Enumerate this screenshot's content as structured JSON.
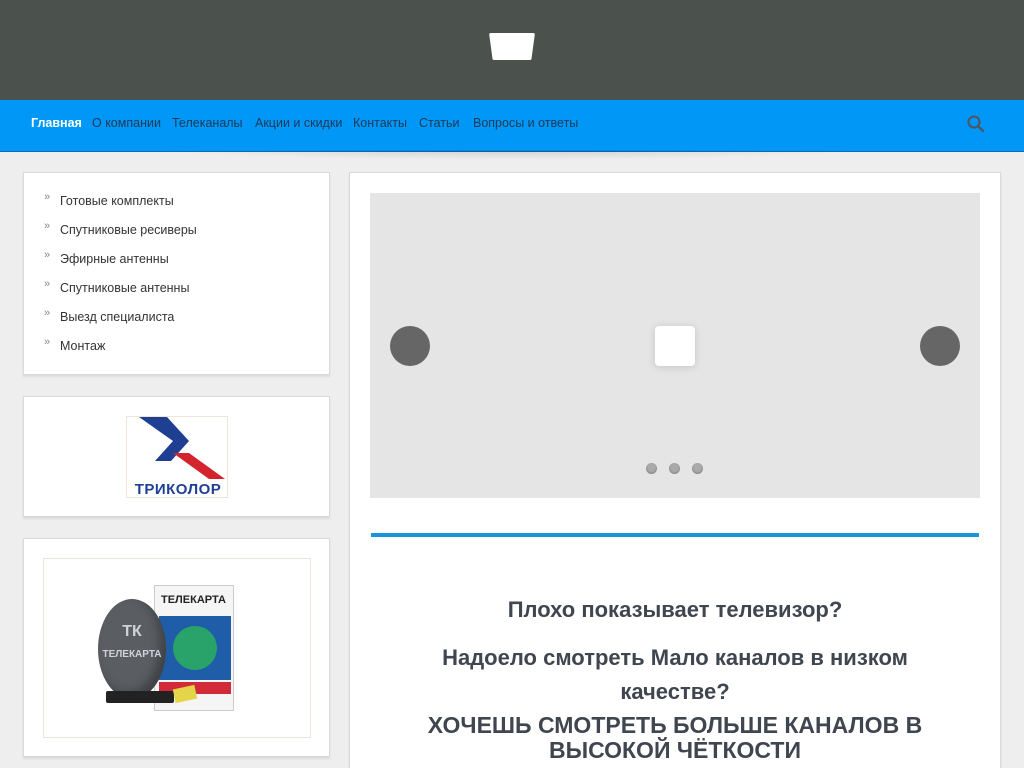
{
  "header": {
    "logo_icon": "logo-icon"
  },
  "nav": {
    "items": [
      {
        "label": "Главная",
        "active": true
      },
      {
        "label": "О компании"
      },
      {
        "label": "Телеканалы"
      },
      {
        "label": "Акции и скидки"
      },
      {
        "label": "Контакты"
      },
      {
        "label": "Статьи"
      },
      {
        "label": "Вопросы и ответы"
      }
    ],
    "search_icon": "search-icon"
  },
  "sidebar": {
    "menu": [
      "Готовые комплекты",
      "Спутниковые ресиверы",
      "Эфирные антенны",
      "Спутниковые антенны",
      "Выезд специалиста",
      "Монтаж"
    ],
    "brand_logo": {
      "text": "ТРИКОЛОР"
    },
    "product_image": {
      "dish_text_top": "ТК",
      "dish_text": "ТЕЛЕКАРТА",
      "box_text": "ТЕЛЕКАРТА"
    }
  },
  "slider": {
    "prev_glyph": "",
    "next_glyph": "",
    "dots": 3,
    "active_slide": 1
  },
  "content": {
    "line1": "Плохо показывает телевизор?",
    "line2": "Надоело смотреть Мало каналов в низком качестве?",
    "line3": "ХОЧЕШЬ СМОТРЕТЬ БОЛЬШЕ КАНАЛОВ В ВЫСОКОЙ ЧЁТКОСТИ"
  },
  "colors": {
    "topbar": "#4b514d",
    "navbar": "#0097f6",
    "accent_line": "#1993db",
    "tricolor_blue": "#1e3f92",
    "tricolor_red": "#d3242d"
  }
}
